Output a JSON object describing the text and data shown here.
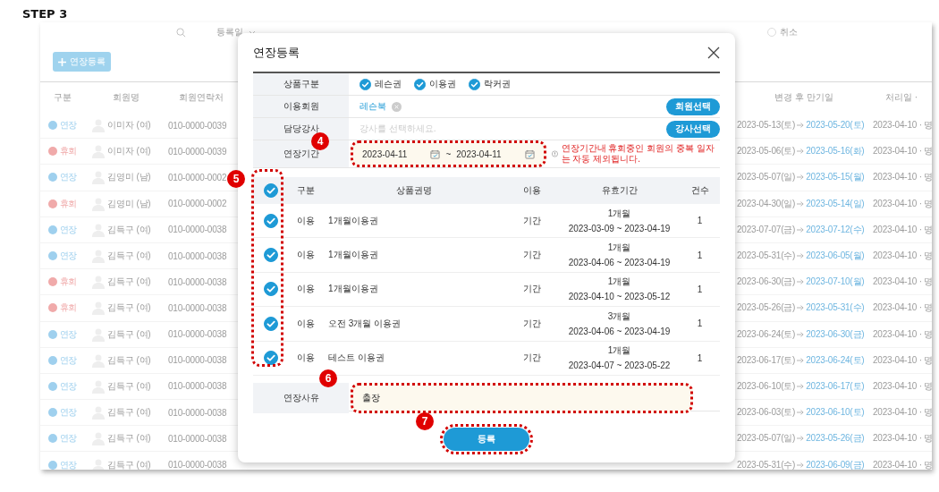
{
  "heading": "STEP 3",
  "background": {
    "filter": {
      "date_type": "등록일",
      "approval_radios": [
        {
          "label": "취소",
          "selected": false
        }
      ]
    },
    "add_button": "연장등록",
    "table": {
      "columns": [
        "구분",
        "회원명",
        "회원연락처",
        "변경 후 만기일",
        "처리일 ·"
      ],
      "rows": [
        {
          "status": "연장",
          "color": "#9fd0ee",
          "name": "이미자",
          "gender": "(여)",
          "phone": "010-0000-0039",
          "before": "2023-05-13(토)",
          "after": "2023-05-20(토)",
          "processed": "2023-04-10 · 명"
        },
        {
          "status": "휴회",
          "color": "#f0aaaa",
          "name": "이미자",
          "gender": "(여)",
          "phone": "010-0000-0039",
          "before": "2023-05-06(토)",
          "after": "2023-05-16(화)",
          "processed": "2023-04-10 · 명"
        },
        {
          "status": "연장",
          "color": "#9fd0ee",
          "name": "김영미",
          "gender": "(남)",
          "phone": "010-0000-0002",
          "before": "2023-05-07(일)",
          "after": "2023-05-15(월)",
          "processed": "2023-04-10 · 명"
        },
        {
          "status": "휴회",
          "color": "#f0aaaa",
          "name": "김영미",
          "gender": "(남)",
          "phone": "010-0000-0002",
          "before": "2023-04-30(일)",
          "after": "2023-05-14(일)",
          "processed": "2023-04-10 · 명"
        },
        {
          "status": "연장",
          "color": "#9fd0ee",
          "name": "김득구",
          "gender": "(여)",
          "phone": "010-0000-0038",
          "before": "2023-07-07(금)",
          "after": "2023-07-12(수)",
          "processed": "2023-04-10 · 명"
        },
        {
          "status": "연장",
          "color": "#9fd0ee",
          "name": "김득구",
          "gender": "(여)",
          "phone": "010-0000-0038",
          "before": "2023-05-31(수)",
          "after": "2023-06-05(월)",
          "processed": "2023-04-10 · 명"
        },
        {
          "status": "휴회",
          "color": "#f0aaaa",
          "name": "김득구",
          "gender": "(여)",
          "phone": "010-0000-0038",
          "before": "2023-06-30(금)",
          "after": "2023-07-10(월)",
          "processed": "2023-04-10 · 명"
        },
        {
          "status": "휴회",
          "color": "#f0aaaa",
          "name": "김득구",
          "gender": "(여)",
          "phone": "010-0000-0038",
          "before": "2023-05-26(금)",
          "after": "2023-05-31(수)",
          "processed": "2023-04-10 · 명"
        },
        {
          "status": "연장",
          "color": "#9fd0ee",
          "name": "김득구",
          "gender": "(여)",
          "phone": "010-0000-0038",
          "before": "2023-06-24(토)",
          "after": "2023-06-30(금)",
          "processed": "2023-04-10 · 명"
        },
        {
          "status": "연장",
          "color": "#9fd0ee",
          "name": "김득구",
          "gender": "(여)",
          "phone": "010-0000-0038",
          "before": "2023-06-17(토)",
          "after": "2023-06-24(토)",
          "processed": "2023-04-10 · 명"
        },
        {
          "status": "연장",
          "color": "#9fd0ee",
          "name": "김득구",
          "gender": "(여)",
          "phone": "010-0000-0038",
          "before": "2023-06-10(토)",
          "after": "2023-06-17(토)",
          "processed": "2023-04-10 · 명"
        },
        {
          "status": "연장",
          "color": "#9fd0ee",
          "name": "김득구",
          "gender": "(여)",
          "phone": "010-0000-0038",
          "before": "2023-06-03(토)",
          "after": "2023-06-10(토)",
          "processed": "2023-04-10 · 명"
        },
        {
          "status": "연장",
          "color": "#9fd0ee",
          "name": "김득구",
          "gender": "(여)",
          "phone": "010-0000-0038",
          "before": "2023-05-07(일)",
          "after": "2023-05-26(금)",
          "processed": "2023-04-10 · 명"
        },
        {
          "status": "연장",
          "color": "#9fd0ee",
          "name": "김득구",
          "gender": "(여)",
          "phone": "010-0000-0038",
          "before": "2023-05-31(수)",
          "after": "2023-06-09(금)",
          "processed": "2023-04-10 · 명"
        }
      ]
    }
  },
  "modal": {
    "title": "연장등록",
    "form": {
      "product_type": {
        "label": "상품구분",
        "options": [
          {
            "label": "레슨권",
            "checked": true
          },
          {
            "label": "이용권",
            "checked": true
          },
          {
            "label": "락커권",
            "checked": true
          }
        ]
      },
      "member": {
        "label": "이용회원",
        "value": "레슨북",
        "button": "회원선택"
      },
      "instructor": {
        "label": "담당강사",
        "placeholder": "강사를 선택하세요.",
        "button": "강사선택"
      },
      "period": {
        "label": "연장기간",
        "step": "4",
        "from": "2023-04-11",
        "separator": "~",
        "to": "2023-04-11",
        "notice": "연장기간내 휴회중인 회원의 중복 일자는 자동 제외됩니다."
      }
    },
    "items": {
      "step": "5",
      "all_checked": true,
      "columns": [
        "구분",
        "상품권명",
        "이용",
        "유효기간",
        "건수"
      ],
      "rows": [
        {
          "checked": true,
          "type": "이용",
          "name": "1개월이용권",
          "usage": "기간",
          "duration": "1개월",
          "period": "2023-03-09 ~ 2023-04-19",
          "count": "1"
        },
        {
          "checked": true,
          "type": "이용",
          "name": "1개월이용권",
          "usage": "기간",
          "duration": "1개월",
          "period": "2023-04-06 ~ 2023-04-19",
          "count": "1"
        },
        {
          "checked": true,
          "type": "이용",
          "name": "1개월이용권",
          "usage": "기간",
          "duration": "1개월",
          "period": "2023-04-10 ~ 2023-05-12",
          "count": "1"
        },
        {
          "checked": true,
          "type": "이용",
          "name": "오전 3개월 이용권",
          "usage": "기간",
          "duration": "3개월",
          "period": "2023-04-06 ~ 2023-04-19",
          "count": "1"
        },
        {
          "checked": true,
          "type": "이용",
          "name": "테스트 이용권",
          "usage": "기간",
          "duration": "1개월",
          "period": "2023-04-07 ~ 2023-05-22",
          "count": "1"
        }
      ]
    },
    "reason": {
      "label": "연장사유",
      "step": "6",
      "value": "출장"
    },
    "submit": {
      "label": "등록",
      "step": "7"
    }
  }
}
